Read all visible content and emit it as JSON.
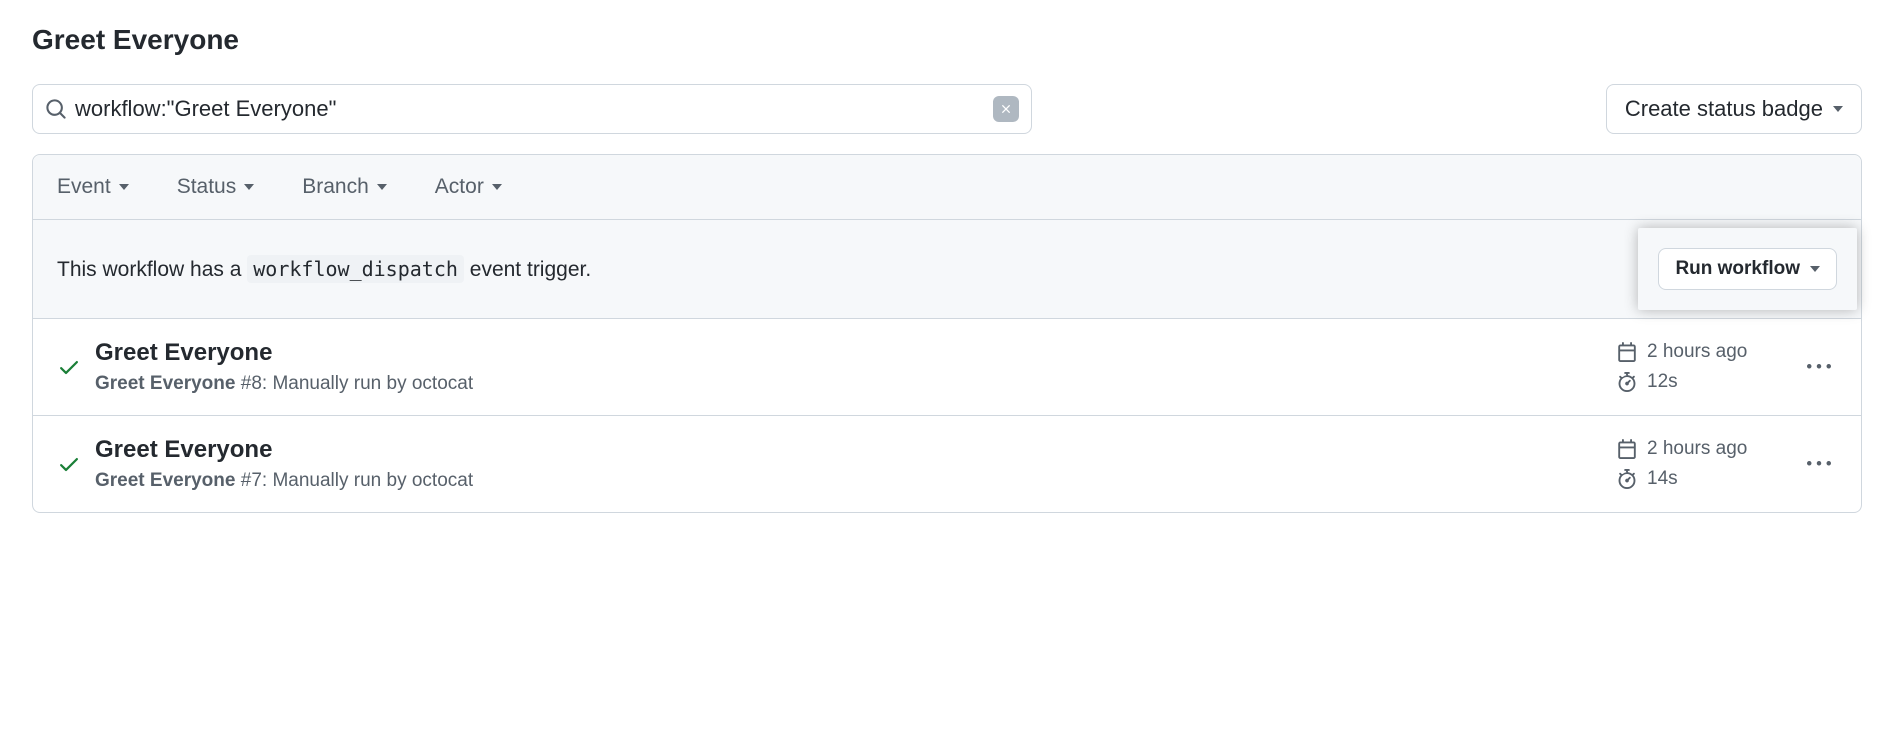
{
  "page_title": "Greet Everyone",
  "search": {
    "value": "workflow:\"Greet Everyone\""
  },
  "create_badge_label": "Create status badge",
  "filters": {
    "event": "Event",
    "status": "Status",
    "branch": "Branch",
    "actor": "Actor"
  },
  "dispatch": {
    "prefix": "This workflow has a ",
    "code": "workflow_dispatch",
    "suffix": " event trigger.",
    "run_label": "Run workflow"
  },
  "runs": [
    {
      "title": "Greet Everyone",
      "workflow_name": "Greet Everyone",
      "run_number": "#8",
      "trigger_text": ": Manually run by ",
      "actor": "octocat",
      "time": "2 hours ago",
      "duration": "12s"
    },
    {
      "title": "Greet Everyone",
      "workflow_name": "Greet Everyone",
      "run_number": "#7",
      "trigger_text": ": Manually run by ",
      "actor": "octocat",
      "time": "2 hours ago",
      "duration": "14s"
    }
  ]
}
